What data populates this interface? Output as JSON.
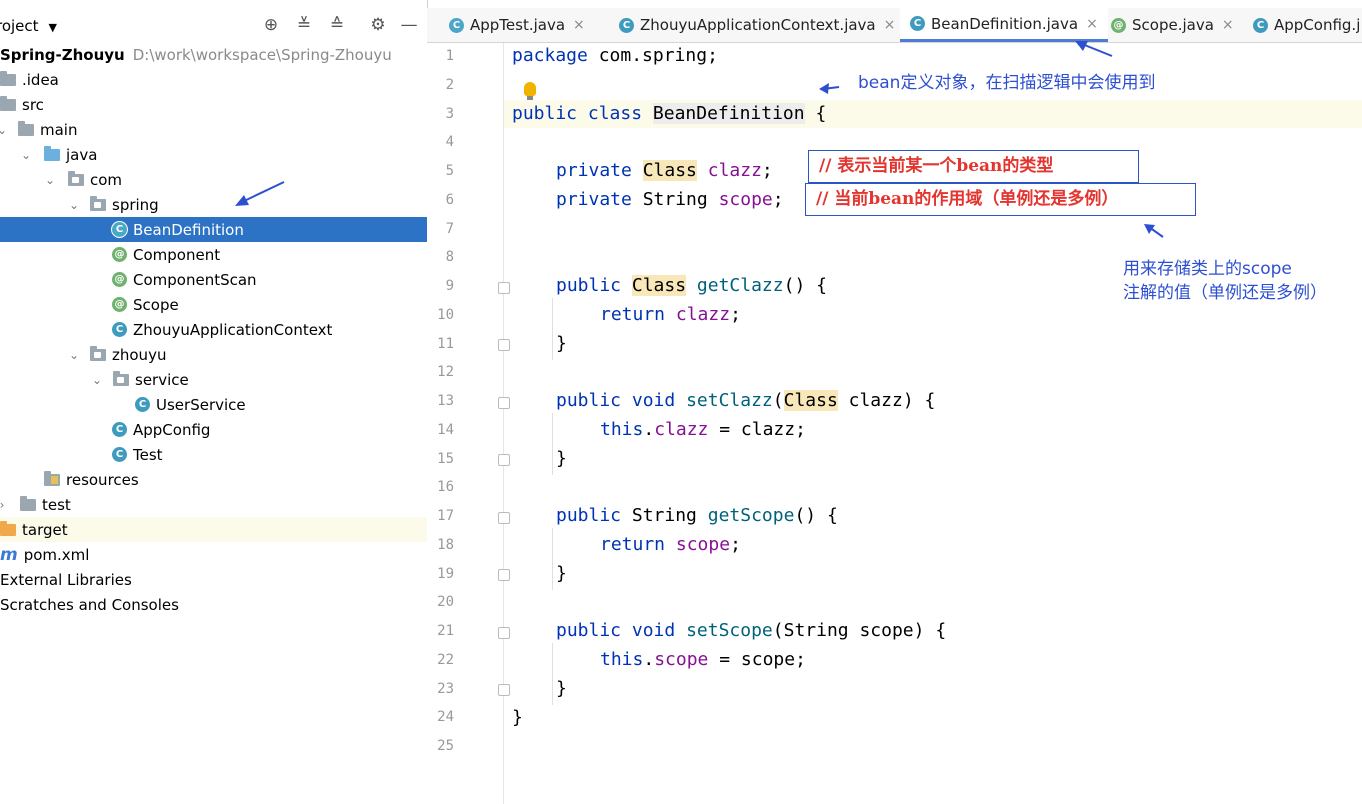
{
  "panel": {
    "title": "roject",
    "dropdown": "▼",
    "tools": [
      "locate-icon",
      "expand-all-icon",
      "collapse-all-icon",
      "gear-icon",
      "hide-icon"
    ],
    "tool_glyphs": [
      "⊕",
      "≚",
      "≙",
      "⚙",
      "—"
    ]
  },
  "tree": [
    {
      "label": "Spring-Zhouyu",
      "hint": "D:\\work\\workspace\\Spring-Zhouyu",
      "icon": "none",
      "chevron": ""
    },
    {
      "label": ".idea",
      "icon": "folder-gray",
      "chevron": ""
    },
    {
      "label": "src",
      "icon": "folder-gray",
      "chevron": ""
    },
    {
      "label": "main",
      "icon": "folder-gray",
      "chevron": "⌄"
    },
    {
      "label": "java",
      "icon": "folder-blue",
      "chevron": "⌄"
    },
    {
      "label": "com",
      "icon": "package",
      "chevron": "⌄"
    },
    {
      "label": "spring",
      "icon": "package",
      "chevron": "⌄"
    },
    {
      "label": "BeanDefinition",
      "icon": "class",
      "chevron": "",
      "selected": true
    },
    {
      "label": "Component",
      "icon": "annotation",
      "chevron": ""
    },
    {
      "label": "ComponentScan",
      "icon": "annotation",
      "chevron": ""
    },
    {
      "label": "Scope",
      "icon": "annotation",
      "chevron": ""
    },
    {
      "label": "ZhouyuApplicationContext",
      "icon": "class",
      "chevron": ""
    },
    {
      "label": "zhouyu",
      "icon": "package",
      "chevron": "⌄"
    },
    {
      "label": "service",
      "icon": "package",
      "chevron": "⌄"
    },
    {
      "label": "UserService",
      "icon": "class",
      "chevron": ""
    },
    {
      "label": "AppConfig",
      "icon": "class",
      "chevron": ""
    },
    {
      "label": "Test",
      "icon": "class",
      "chevron": ""
    },
    {
      "label": "resources",
      "icon": "resources",
      "chevron": ""
    },
    {
      "label": "test",
      "icon": "folder-gray",
      "chevron": "›"
    },
    {
      "label": "target",
      "icon": "folder-orange",
      "chevron": ""
    },
    {
      "label": "pom.xml",
      "icon": "maven",
      "chevron": ""
    },
    {
      "label": "External Libraries",
      "icon": "none",
      "chevron": ""
    },
    {
      "label": "Scratches and Consoles",
      "icon": "none",
      "chevron": ""
    }
  ],
  "tabs": [
    {
      "label": "AppTest.java",
      "icon": "C",
      "close": "×"
    },
    {
      "label": "ZhouyuApplicationContext.java",
      "icon": "C",
      "close": "×"
    },
    {
      "label": "BeanDefinition.java",
      "icon": "C",
      "close": "×",
      "active": true
    },
    {
      "label": "Scope.java",
      "icon": "@",
      "close": "×"
    },
    {
      "label": "AppConfig.j",
      "icon": "C",
      "close": ""
    }
  ],
  "line_numbers": [
    "1",
    "2",
    "3",
    "4",
    "5",
    "6",
    "7",
    "8",
    "9",
    "10",
    "11",
    "12",
    "13",
    "14",
    "15",
    "16",
    "17",
    "18",
    "19",
    "20",
    "21",
    "22",
    "23",
    "24",
    "25"
  ],
  "code": {
    "l1": [
      "package",
      " com.spring;"
    ],
    "l3": [
      "public class",
      " ",
      "BeanDefinition",
      " {"
    ],
    "l5": [
      "private",
      " ",
      "Class",
      " ",
      "clazz",
      ";"
    ],
    "l6": [
      "private",
      " String ",
      "scope",
      ";"
    ],
    "l9": [
      "public",
      " ",
      "Class",
      " ",
      "getClazz",
      "() {"
    ],
    "l10": [
      "return",
      " ",
      "clazz",
      ";"
    ],
    "l11": "}",
    "l13": [
      "public void",
      " ",
      "setClazz",
      "(",
      "Class",
      " clazz) {"
    ],
    "l14": [
      "this",
      ".",
      "clazz",
      " = clazz;"
    ],
    "l15": "}",
    "l17": [
      "public",
      " String ",
      "getScope",
      "() {"
    ],
    "l18": [
      "return",
      " ",
      "scope",
      ";"
    ],
    "l19": "}",
    "l21": [
      "public void",
      " ",
      "setScope",
      "(String scope) {"
    ],
    "l22": [
      "this",
      ".",
      "scope",
      " = scope;"
    ],
    "l23": "}",
    "l24": "}"
  },
  "comments": {
    "c1": "// 表示当前某一个bean的类型",
    "c2": "// 当前bean的作用域（单例还是多例）"
  },
  "annotations": {
    "a1": "bean定义对象，在扫描逻辑中会使用到",
    "a2_line1": "用来存储类上的scope",
    "a2_line2": "注解的值（单例还是多例）"
  }
}
